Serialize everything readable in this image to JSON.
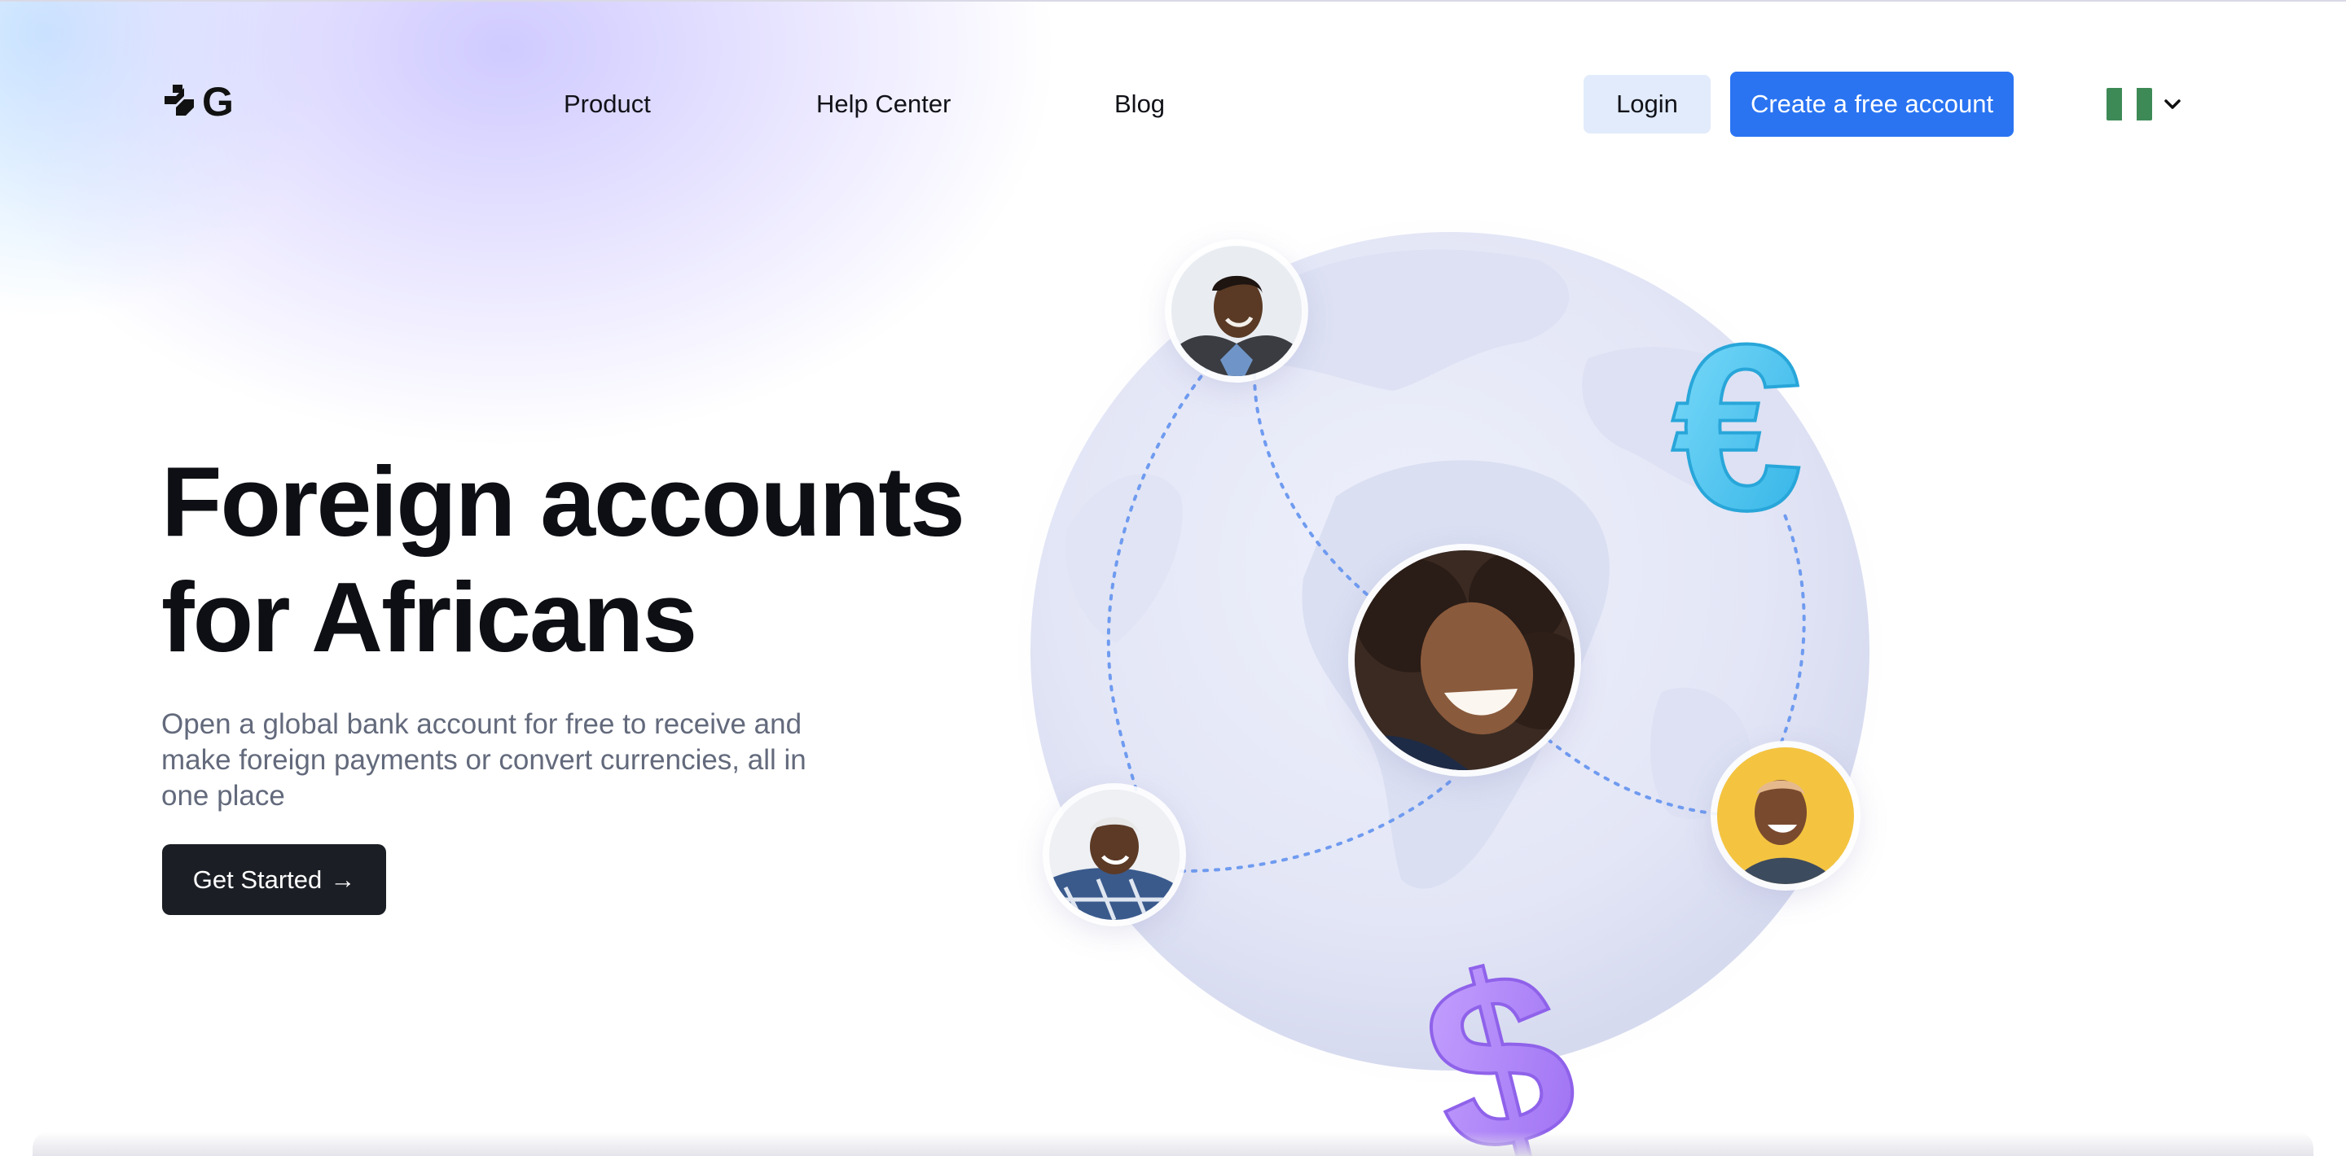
{
  "header": {
    "logo_icon": "sg-logo-icon",
    "nav": [
      {
        "label": "Product"
      },
      {
        "label": "Help Center"
      },
      {
        "label": "Blog"
      }
    ],
    "login_label": "Login",
    "create_account_label": "Create a free account",
    "language": {
      "flag_icon": "nigeria-flag-icon",
      "chevron_icon": "chevron-down-icon",
      "flag_colors": [
        "#3d8a57",
        "#ffffff",
        "#3d8a57"
      ]
    }
  },
  "hero": {
    "title_line1": "Foreign accounts",
    "title_line2": "for Africans",
    "subtitle": "Open a global bank account for free to receive and make foreign payments or convert currencies, all in one place",
    "cta_label": "Get Started",
    "cta_arrow": "→"
  },
  "illustration": {
    "globe_icon": "globe-illustration",
    "euro_icon": "euro-symbol-icon",
    "dollar_icon": "dollar-symbol-icon",
    "euro_color": "#48c6f0",
    "dollar_color": "#a87df5",
    "avatars": [
      "avatar-man-top",
      "avatar-woman-center",
      "avatar-woman-left",
      "avatar-woman-right"
    ]
  },
  "colors": {
    "primary": "#2a74f2",
    "dark": "#1b1e24",
    "login_bg": "#e1ebfb",
    "subtitle_text": "#636a7c"
  }
}
